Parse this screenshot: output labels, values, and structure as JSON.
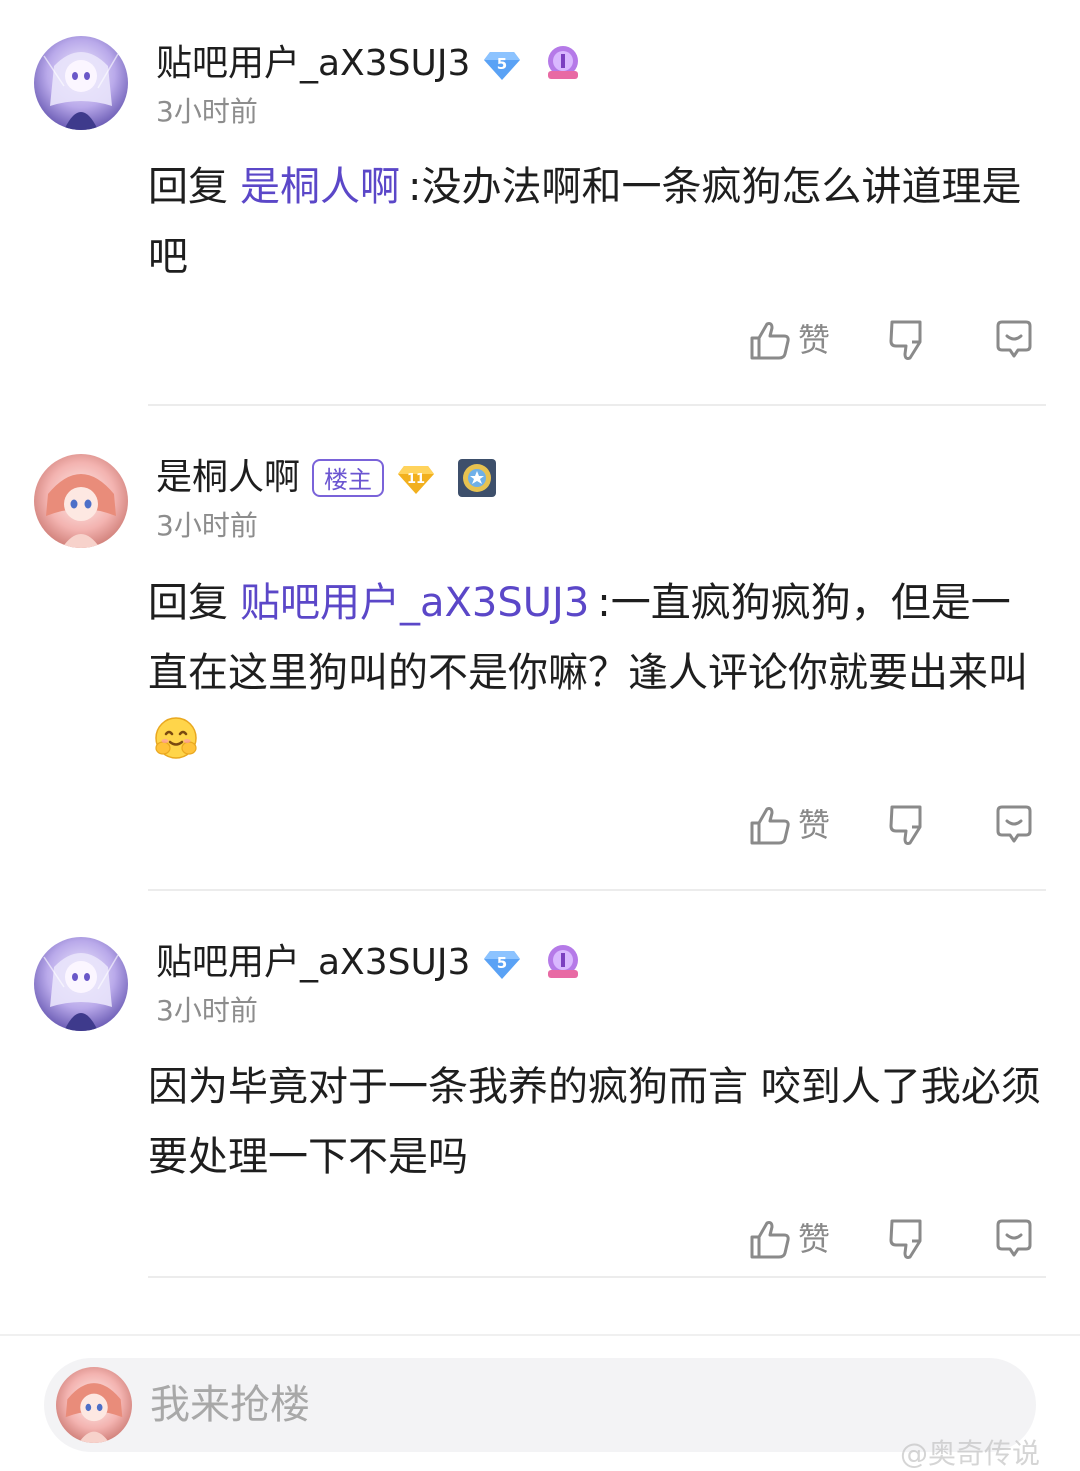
{
  "colors": {
    "mention": "#5b47c8",
    "owner_badge": "#6b55d1",
    "timestamp": "#8d8d8d",
    "action_icon": "#8a8a8a",
    "divider": "#ececec"
  },
  "comments": [
    {
      "username": "贴吧用户_aX3SUJ3",
      "is_owner": false,
      "level": "5",
      "level_color": "#5aa2f5",
      "avatar": "purple-anime-avatar",
      "timestamp": "3小时前",
      "reply_prefix": "回复",
      "mention": "是桐人啊",
      "text": ":没办法啊和一条疯狗怎么讲道理是吧",
      "like_label": "赞"
    },
    {
      "username": "是桐人啊",
      "is_owner": true,
      "owner_label": "楼主",
      "level": "11",
      "level_color": "#f2b01e",
      "avatar": "pink-anime-avatar",
      "timestamp": "3小时前",
      "reply_prefix": "回复",
      "mention": "贴吧用户_aX3SUJ3",
      "text": ":一直疯狗疯狗，但是一直在这里狗叫的不是你嘛？逢人评论你就要出来叫",
      "emoji": "smiling-hands-emoji",
      "like_label": "赞"
    },
    {
      "username": "贴吧用户_aX3SUJ3",
      "is_owner": false,
      "level": "5",
      "level_color": "#5aa2f5",
      "avatar": "purple-anime-avatar",
      "timestamp": "3小时前",
      "text": "因为毕竟对于一条我养的疯狗而言 咬到人了我必须要处理一下不是吗",
      "like_label": "赞"
    }
  ],
  "input": {
    "placeholder": "我来抢楼",
    "avatar": "pink-anime-avatar"
  },
  "watermark": "@奥奇传说"
}
